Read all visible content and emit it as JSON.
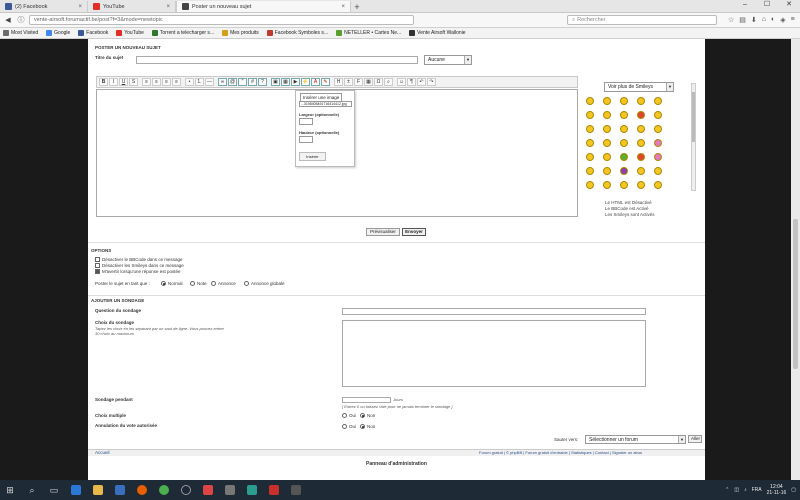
{
  "browser": {
    "tabs": [
      {
        "label": "(2) Facebook",
        "color": "#3b5998"
      },
      {
        "label": "YouTube",
        "color": "#e52d27"
      },
      {
        "label": "Poster un nouveau sujet",
        "color": "#444444"
      }
    ],
    "url": "vente-airsoft.forumactif.be/post?f=3&mode=newtopic",
    "search_placeholder": "Rechercher",
    "bookmarks": [
      {
        "label": "Most Visited",
        "color": "#6a6a6a"
      },
      {
        "label": "Google",
        "color": "#4285f4"
      },
      {
        "label": "Facebook",
        "color": "#3b5998"
      },
      {
        "label": "YouTube",
        "color": "#e52d27"
      },
      {
        "label": "Torrent a telecharger s...",
        "color": "#2d7a2d"
      },
      {
        "label": "Mes produits",
        "color": "#d4a017"
      },
      {
        "label": "Facebook Symboles s...",
        "color": "#c0392b"
      },
      {
        "label": "NETELLER • Cartes Ne...",
        "color": "#5a9e2d"
      },
      {
        "label": "Vente Airsoft Wallonie",
        "color": "#333333"
      }
    ]
  },
  "form": {
    "section_title": "Poster un nouveau sujet",
    "subject_label": "Titre du sujet",
    "subject_value": "",
    "prefix_select": "Aucune",
    "smileys_select": "Voir plus de Smileys",
    "status_lines": [
      "Le HTML est Désactivé",
      "Le BBCode est Activé",
      "Les Smileys sont Activés"
    ],
    "preview_button": "Prévisualiser",
    "send_button": "Envoyer"
  },
  "image_popup": {
    "tooltip": "Insérer une image",
    "url_value": "...3198405491716414412.jpg",
    "width_label": "Largeur (optionnelle)",
    "height_label": "Hauteur (optionnelle)",
    "insert_button": "Insérer"
  },
  "options": {
    "title": "Options",
    "checks": [
      {
        "label": "Désactiver le BBCode dans ce message",
        "checked": false
      },
      {
        "label": "Désactiver les Smileys dans ce message",
        "checked": false
      },
      {
        "label": "M'avertir lorsqu'une réponse est postée",
        "checked": true
      }
    ],
    "post_as_label": "Poster le sujet en tant que :",
    "post_as_options": [
      "Normal",
      "Note",
      "Annonce",
      "Annonce globale"
    ]
  },
  "poll": {
    "title": "Ajouter un sondage",
    "question_label": "Question du sondage",
    "choices_label": "Choix du sondage",
    "choices_note": "Tapez les choix en les séparant par un saut de ligne. Vous pouvez entrer 30 choix au maximum",
    "duration_label": "Sondage pendant",
    "duration_unit": "Jours",
    "duration_note": "[ Entrez 0 ou laissez vide pour ne jamais terminer le sondage ]",
    "multiple_label": "Choix multiple",
    "revote_label": "Annulation du vote autorisée",
    "yes": "Oui",
    "no": "Non"
  },
  "footer": {
    "jump_label": "Sauter vers:",
    "jump_select": "Sélectionner un forum",
    "go_button": "Aller",
    "home_link": "Accueil",
    "links": "Forum gratuit | © phpBB | Forum gratuit d'entraide | Statistiques | Contact | Signaler un abus",
    "admin_link": "Panneau d'administration"
  },
  "taskbar": {
    "lang": "FRA",
    "time": "12:04",
    "date": "21-11-16"
  }
}
